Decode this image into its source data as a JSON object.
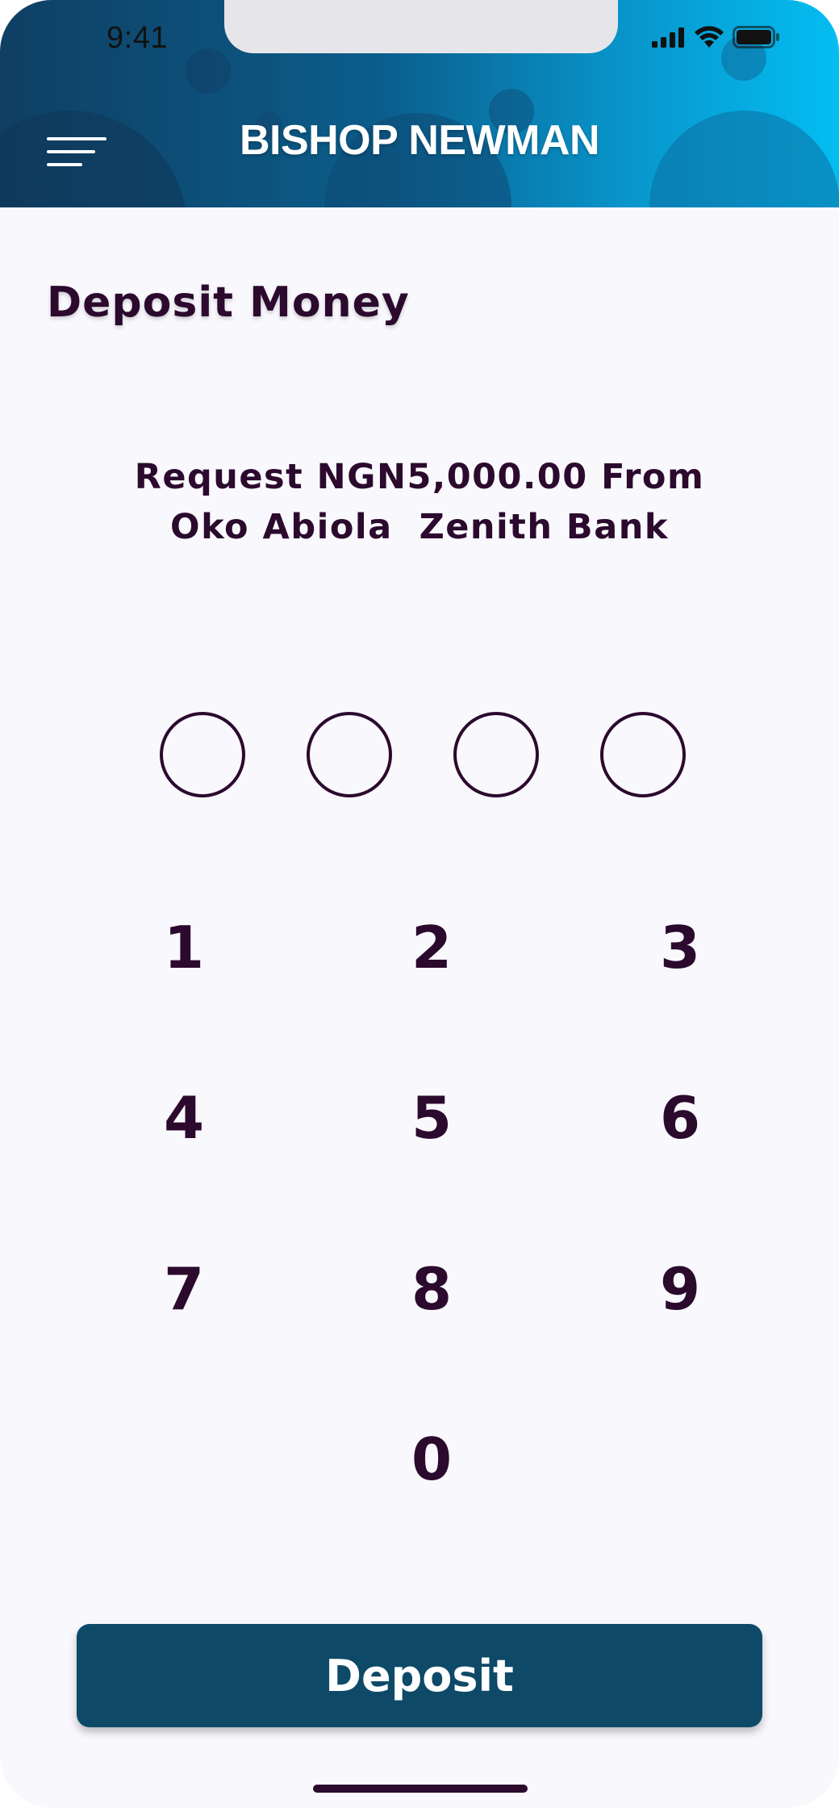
{
  "status_bar": {
    "time": "9:41",
    "icons": [
      "cellular-signal-icon",
      "wifi-icon",
      "battery-icon"
    ]
  },
  "header": {
    "menu_icon": "hamburger-menu-icon",
    "title": "BISHOP NEWMAN",
    "colors": {
      "gradient_start": "#0f3f63",
      "gradient_end": "#04bdf2"
    }
  },
  "page": {
    "title": "Deposit Money",
    "request_line1": "Request NGN5,000.00 From",
    "request_line2": "Oko Abiola  Zenith Bank"
  },
  "pin": {
    "length": 4,
    "filled": 0
  },
  "keypad": {
    "keys": [
      "1",
      "2",
      "3",
      "4",
      "5",
      "6",
      "7",
      "8",
      "9",
      "0"
    ]
  },
  "actions": {
    "deposit_label": "Deposit"
  },
  "colors": {
    "text_primary": "#2b0a2e",
    "button_bg": "#0e4a68",
    "page_bg": "#f9f8fd"
  }
}
